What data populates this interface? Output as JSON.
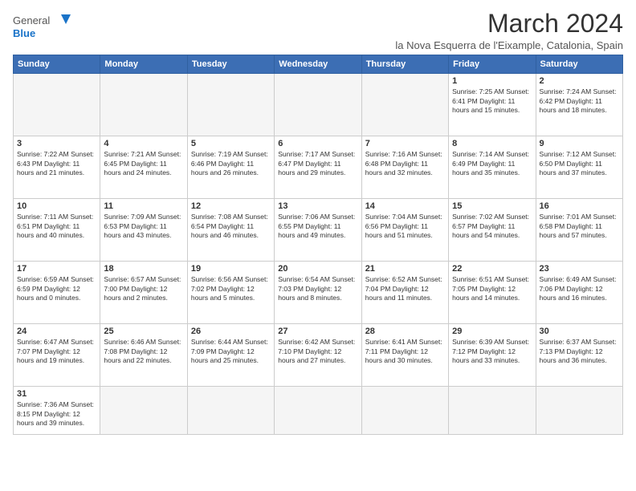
{
  "logo": {
    "line1": "General",
    "line2": "Blue"
  },
  "title": "March 2024",
  "location": "la Nova Esquerra de l'Eixample, Catalonia, Spain",
  "headers": [
    "Sunday",
    "Monday",
    "Tuesday",
    "Wednesday",
    "Thursday",
    "Friday",
    "Saturday"
  ],
  "weeks": [
    [
      {
        "day": "",
        "info": ""
      },
      {
        "day": "",
        "info": ""
      },
      {
        "day": "",
        "info": ""
      },
      {
        "day": "",
        "info": ""
      },
      {
        "day": "",
        "info": ""
      },
      {
        "day": "1",
        "info": "Sunrise: 7:25 AM\nSunset: 6:41 PM\nDaylight: 11 hours and 15 minutes."
      },
      {
        "day": "2",
        "info": "Sunrise: 7:24 AM\nSunset: 6:42 PM\nDaylight: 11 hours and 18 minutes."
      }
    ],
    [
      {
        "day": "3",
        "info": "Sunrise: 7:22 AM\nSunset: 6:43 PM\nDaylight: 11 hours and 21 minutes."
      },
      {
        "day": "4",
        "info": "Sunrise: 7:21 AM\nSunset: 6:45 PM\nDaylight: 11 hours and 24 minutes."
      },
      {
        "day": "5",
        "info": "Sunrise: 7:19 AM\nSunset: 6:46 PM\nDaylight: 11 hours and 26 minutes."
      },
      {
        "day": "6",
        "info": "Sunrise: 7:17 AM\nSunset: 6:47 PM\nDaylight: 11 hours and 29 minutes."
      },
      {
        "day": "7",
        "info": "Sunrise: 7:16 AM\nSunset: 6:48 PM\nDaylight: 11 hours and 32 minutes."
      },
      {
        "day": "8",
        "info": "Sunrise: 7:14 AM\nSunset: 6:49 PM\nDaylight: 11 hours and 35 minutes."
      },
      {
        "day": "9",
        "info": "Sunrise: 7:12 AM\nSunset: 6:50 PM\nDaylight: 11 hours and 37 minutes."
      }
    ],
    [
      {
        "day": "10",
        "info": "Sunrise: 7:11 AM\nSunset: 6:51 PM\nDaylight: 11 hours and 40 minutes."
      },
      {
        "day": "11",
        "info": "Sunrise: 7:09 AM\nSunset: 6:53 PM\nDaylight: 11 hours and 43 minutes."
      },
      {
        "day": "12",
        "info": "Sunrise: 7:08 AM\nSunset: 6:54 PM\nDaylight: 11 hours and 46 minutes."
      },
      {
        "day": "13",
        "info": "Sunrise: 7:06 AM\nSunset: 6:55 PM\nDaylight: 11 hours and 49 minutes."
      },
      {
        "day": "14",
        "info": "Sunrise: 7:04 AM\nSunset: 6:56 PM\nDaylight: 11 hours and 51 minutes."
      },
      {
        "day": "15",
        "info": "Sunrise: 7:02 AM\nSunset: 6:57 PM\nDaylight: 11 hours and 54 minutes."
      },
      {
        "day": "16",
        "info": "Sunrise: 7:01 AM\nSunset: 6:58 PM\nDaylight: 11 hours and 57 minutes."
      }
    ],
    [
      {
        "day": "17",
        "info": "Sunrise: 6:59 AM\nSunset: 6:59 PM\nDaylight: 12 hours and 0 minutes."
      },
      {
        "day": "18",
        "info": "Sunrise: 6:57 AM\nSunset: 7:00 PM\nDaylight: 12 hours and 2 minutes."
      },
      {
        "day": "19",
        "info": "Sunrise: 6:56 AM\nSunset: 7:02 PM\nDaylight: 12 hours and 5 minutes."
      },
      {
        "day": "20",
        "info": "Sunrise: 6:54 AM\nSunset: 7:03 PM\nDaylight: 12 hours and 8 minutes."
      },
      {
        "day": "21",
        "info": "Sunrise: 6:52 AM\nSunset: 7:04 PM\nDaylight: 12 hours and 11 minutes."
      },
      {
        "day": "22",
        "info": "Sunrise: 6:51 AM\nSunset: 7:05 PM\nDaylight: 12 hours and 14 minutes."
      },
      {
        "day": "23",
        "info": "Sunrise: 6:49 AM\nSunset: 7:06 PM\nDaylight: 12 hours and 16 minutes."
      }
    ],
    [
      {
        "day": "24",
        "info": "Sunrise: 6:47 AM\nSunset: 7:07 PM\nDaylight: 12 hours and 19 minutes."
      },
      {
        "day": "25",
        "info": "Sunrise: 6:46 AM\nSunset: 7:08 PM\nDaylight: 12 hours and 22 minutes."
      },
      {
        "day": "26",
        "info": "Sunrise: 6:44 AM\nSunset: 7:09 PM\nDaylight: 12 hours and 25 minutes."
      },
      {
        "day": "27",
        "info": "Sunrise: 6:42 AM\nSunset: 7:10 PM\nDaylight: 12 hours and 27 minutes."
      },
      {
        "day": "28",
        "info": "Sunrise: 6:41 AM\nSunset: 7:11 PM\nDaylight: 12 hours and 30 minutes."
      },
      {
        "day": "29",
        "info": "Sunrise: 6:39 AM\nSunset: 7:12 PM\nDaylight: 12 hours and 33 minutes."
      },
      {
        "day": "30",
        "info": "Sunrise: 6:37 AM\nSunset: 7:13 PM\nDaylight: 12 hours and 36 minutes."
      }
    ],
    [
      {
        "day": "31",
        "info": "Sunrise: 7:36 AM\nSunset: 8:15 PM\nDaylight: 12 hours and 39 minutes."
      },
      {
        "day": "",
        "info": ""
      },
      {
        "day": "",
        "info": ""
      },
      {
        "day": "",
        "info": ""
      },
      {
        "day": "",
        "info": ""
      },
      {
        "day": "",
        "info": ""
      },
      {
        "day": "",
        "info": ""
      }
    ]
  ]
}
